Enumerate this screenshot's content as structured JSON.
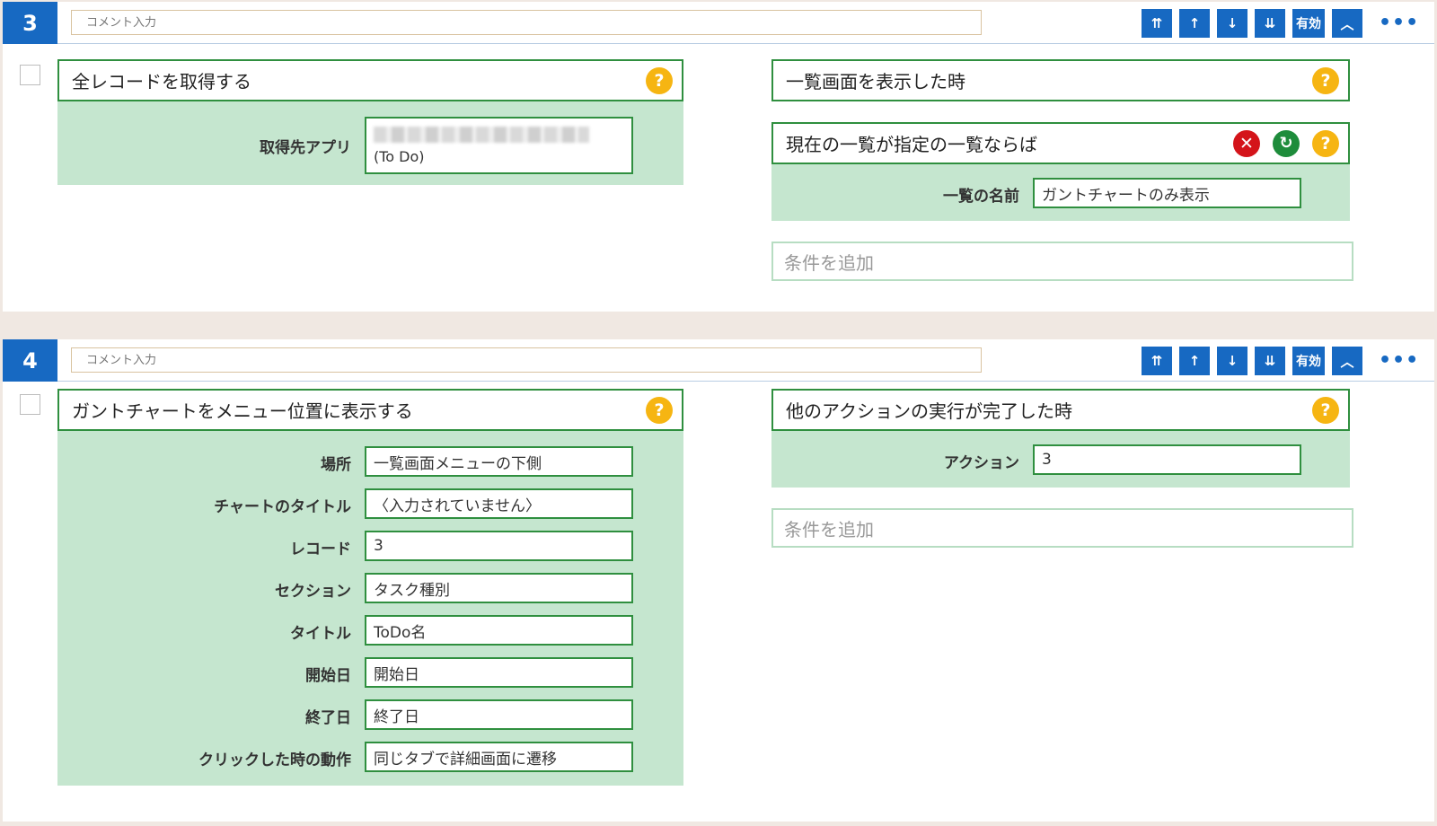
{
  "blocks": [
    {
      "number": "3",
      "comment_placeholder": "コメント入力",
      "toolbar": {
        "enabled_label": "有効"
      },
      "action": {
        "title": "全レコードを取得する",
        "fields": [
          {
            "label": "取得先アプリ",
            "value_sub": "(To Do)"
          }
        ]
      },
      "conditions": [
        {
          "title": "一覧画面を表示した時"
        },
        {
          "title": "現在の一覧が指定の一覧ならば",
          "fields": [
            {
              "label": "一覧の名前",
              "value": "ガントチャートのみ表示"
            }
          ]
        }
      ],
      "add_condition": "条件を追加"
    },
    {
      "number": "4",
      "comment_placeholder": "コメント入力",
      "toolbar": {
        "enabled_label": "有効"
      },
      "action": {
        "title": "ガントチャートをメニュー位置に表示する",
        "fields": [
          {
            "label": "場所",
            "value": "一覧画面メニューの下側"
          },
          {
            "label": "チャートのタイトル",
            "value": "〈入力されていません〉"
          },
          {
            "label": "レコード",
            "value": "3"
          },
          {
            "label": "セクション",
            "value": "タスク種別"
          },
          {
            "label": "タイトル",
            "value": "ToDo名"
          },
          {
            "label": "開始日",
            "value": "開始日"
          },
          {
            "label": "終了日",
            "value": "終了日"
          },
          {
            "label": "クリックした時の動作",
            "value": "同じタブで詳細画面に遷移"
          }
        ]
      },
      "conditions": [
        {
          "title": "他のアクションの実行が完了した時",
          "fields": [
            {
              "label": "アクション",
              "value": "3"
            }
          ]
        }
      ],
      "add_condition": "条件を追加"
    }
  ],
  "icons": {
    "move_top": "move-to-top-icon",
    "move_up": "move-up-icon",
    "move_down": "move-down-icon",
    "move_bottom": "move-to-bottom-icon",
    "collapse": "chevron-up-icon",
    "more": "more-horizontal-icon",
    "help": "help-icon",
    "delete": "delete-icon",
    "refresh": "refresh-icon"
  },
  "colors": {
    "accent_blue": "#1769c2",
    "field_green": "#2f8f3f",
    "panel_green": "#c5e6cf",
    "help_yellow": "#f6b512",
    "delete_red": "#d4141a",
    "refresh_green": "#1e8c3b"
  }
}
